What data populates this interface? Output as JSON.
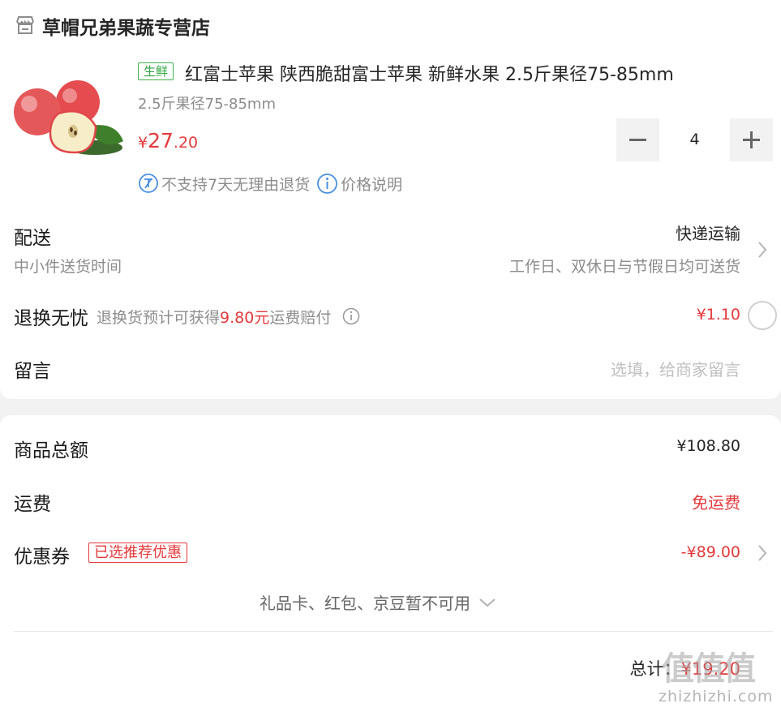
{
  "store": {
    "name": "草帽兄弟果蔬专营店"
  },
  "product": {
    "tag": "生鲜",
    "title": "红富士苹果 陕西脆甜富士苹果 新鲜水果 2.5斤果径75-85mm",
    "spec": "2.5斤果径75-85mm",
    "price_currency": "¥",
    "price_int": "27",
    "price_dec": ".20",
    "quantity": "4",
    "return_policy": "不支持7天无理由退货",
    "price_note": "价格说明"
  },
  "delivery": {
    "label": "配送",
    "sublabel": "中小件送货时间",
    "method": "快递运输",
    "schedule": "工作日、双休日与节假日均可送货"
  },
  "return_insurance": {
    "label": "退换无忧",
    "desc_pre": "退换货预计可获得",
    "desc_amount": "9.80元",
    "desc_post": "运费赔付",
    "price": "¥1.10"
  },
  "message": {
    "label": "留言",
    "placeholder": "选填，给商家留言"
  },
  "summary": {
    "goods_total_label": "商品总额",
    "goods_total": "¥108.80",
    "shipping_label": "运费",
    "shipping": "免运费",
    "coupon_label": "优惠券",
    "coupon_badge": "已选推荐优惠",
    "coupon_value": "-¥89.00",
    "unavailable": "礼品卡、红包、京豆暂不可用",
    "total_label": "总计：",
    "total": "¥19.20"
  },
  "watermark": {
    "text": "值值值",
    "url": "zhizhizhi.com"
  },
  "colors": {
    "accent": "#e4393c",
    "fresh_tag": "#2fa640",
    "info_icon": "#4a90e2"
  }
}
